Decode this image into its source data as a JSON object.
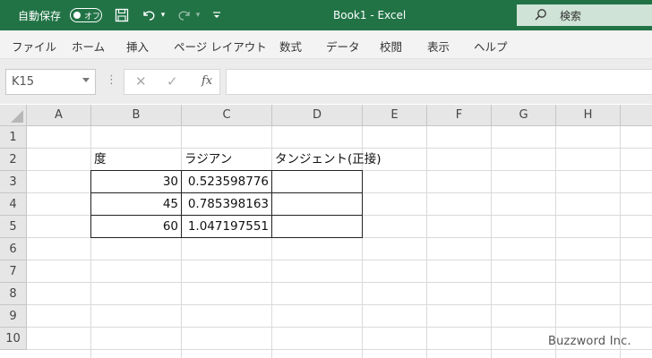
{
  "titlebar": {
    "autosave_label": "自動保存",
    "autosave_state": "オフ",
    "doc_title": "Book1  -  Excel",
    "search_label": "検索"
  },
  "ribbon": {
    "tabs": [
      "ファイル",
      "ホーム",
      "挿入",
      "ページ レイアウト",
      "数式",
      "データ",
      "校閲",
      "表示",
      "ヘルプ"
    ]
  },
  "formula_bar": {
    "name_box": "K15",
    "fx_label": "fx",
    "formula": ""
  },
  "sheet": {
    "columns": [
      "A",
      "B",
      "C",
      "D",
      "E",
      "F",
      "G",
      "H"
    ],
    "rows": [
      "1",
      "2",
      "3",
      "4",
      "5",
      "6",
      "7",
      "8",
      "9",
      "10"
    ],
    "headers": {
      "b2": "度",
      "c2": "ラジアン",
      "d2": "タンジェント(正接)"
    },
    "data": [
      {
        "degree": "30",
        "radian": "0.523598776",
        "tangent": ""
      },
      {
        "degree": "45",
        "radian": "0.785398163",
        "tangent": ""
      },
      {
        "degree": "60",
        "radian": "1.047197551",
        "tangent": ""
      }
    ]
  },
  "watermark": "Buzzword Inc.",
  "colors": {
    "titlebar": "#217346",
    "search_box": "#cfe3d6",
    "ribbon": "#f3f3f3",
    "header": "#e6e6e6"
  }
}
